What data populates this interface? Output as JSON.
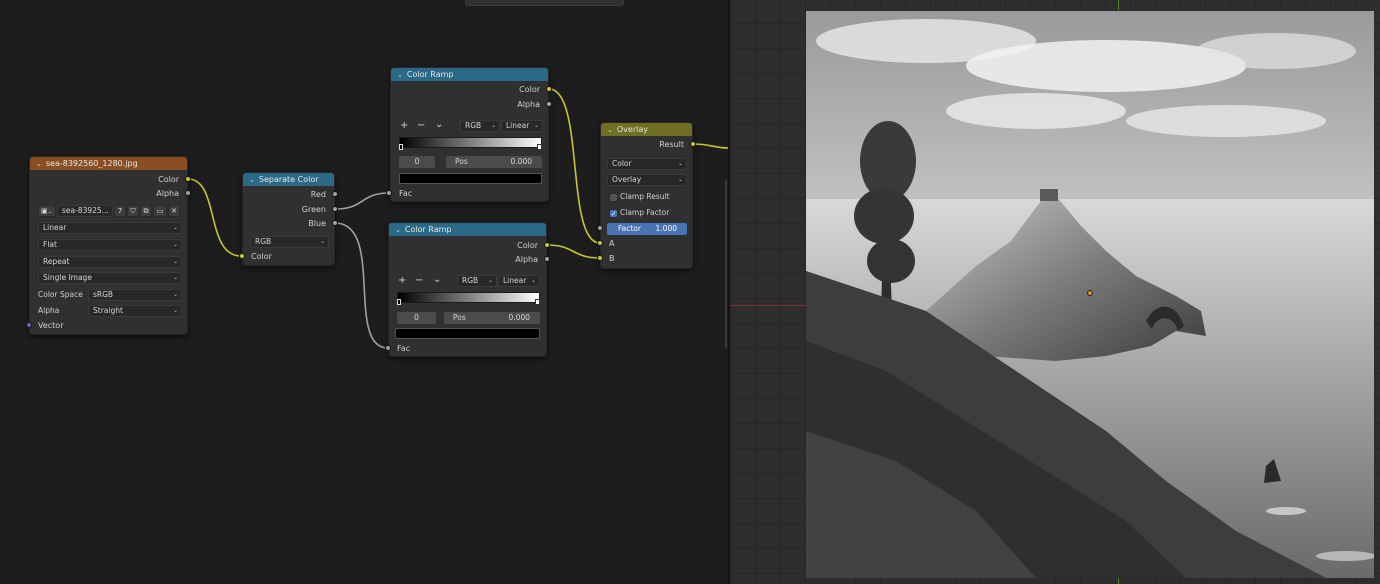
{
  "image_node": {
    "title": "sea-8392560_1280.jpg",
    "outputs": {
      "color": "Color",
      "alpha": "Alpha"
    },
    "image_name": "sea-83925...",
    "user_count": "7",
    "interpolation": "Linear",
    "projection": "Flat",
    "extension": "Repeat",
    "source": "Single Image",
    "color_space_label": "Color Space",
    "color_space": "sRGB",
    "alpha_label": "Alpha",
    "alpha_mode": "Straight",
    "input_vector": "Vector",
    "header_color": "#8b4e22"
  },
  "separate_node": {
    "title": "Separate Color",
    "outputs": {
      "red": "Red",
      "green": "Green",
      "blue": "Blue"
    },
    "mode": "RGB",
    "input_color": "Color",
    "header_color": "#2a6a87"
  },
  "ramp_top": {
    "title": "Color Ramp",
    "outputs": {
      "color": "Color",
      "alpha": "Alpha"
    },
    "add": "+",
    "remove": "−",
    "menu": "⌄",
    "color_mode": "RGB",
    "interpolation": "Linear",
    "index": "0",
    "pos_label": "Pos",
    "pos_value": "0.000",
    "input_fac": "Fac"
  },
  "ramp_bottom": {
    "title": "Color Ramp",
    "outputs": {
      "color": "Color",
      "alpha": "Alpha"
    },
    "add": "+",
    "remove": "−",
    "menu": "⌄",
    "color_mode": "RGB",
    "interpolation": "Linear",
    "index": "0",
    "pos_label": "Pos",
    "pos_value": "0.000",
    "input_fac": "Fac"
  },
  "overlay_node": {
    "title": "Overlay",
    "output_result": "Result",
    "data_type": "Color",
    "blend_mode": "Overlay",
    "clamp_result_label": "Clamp Result",
    "clamp_result": false,
    "clamp_factor_label": "Clamp Factor",
    "clamp_factor": true,
    "factor_label": "Factor",
    "factor_value": "1.000",
    "input_a": "A",
    "input_b": "B",
    "header_color": "#6f6e22"
  },
  "viewer": {
    "socket_color_yellow": "#c7c729",
    "socket_color_gray": "#a1a1a1",
    "socket_color_purple": "#6363c7"
  }
}
